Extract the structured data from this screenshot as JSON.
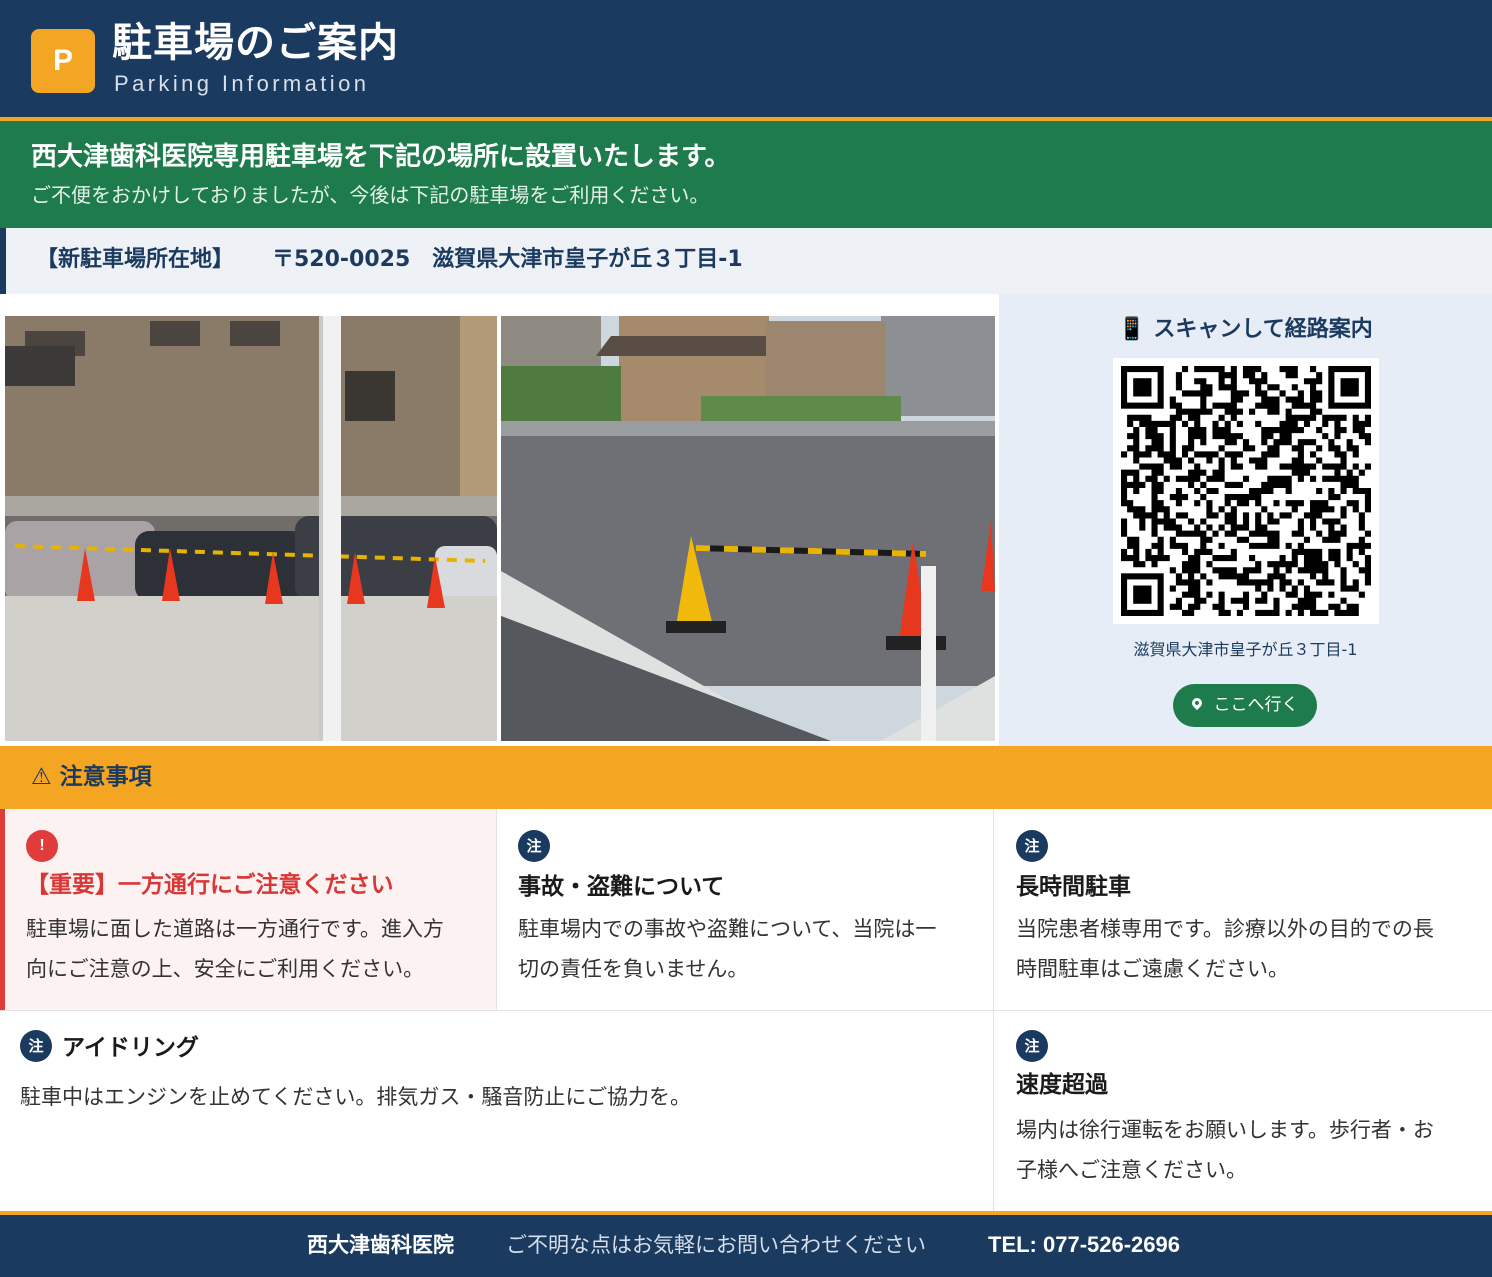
{
  "header": {
    "badge": "P",
    "title": "駐車場のご案内",
    "subtitle": "Parking Information"
  },
  "notice": {
    "main": "西大津歯科医院専用駐車場を下記の場所に設置いたします。",
    "sub": "ご不便をおかけしておりましたが、今後は下記の駐車場をご利用ください。"
  },
  "address": {
    "label": "【新駐車場所在地】",
    "text": "〒520-0025　滋賀県大津市皇子が丘３丁目-1"
  },
  "qr": {
    "title": "📱 スキャンして経路案内",
    "address": "滋賀県大津市皇子が丘３丁目-1",
    "button_label": "ここへ行く"
  },
  "caution": {
    "title": "⚠ 注意事項",
    "items": [
      {
        "badge": "!",
        "title": "【重要】一方通行にご注意ください",
        "lines": [
          "駐車場に面した道路は一方通行です。進入方",
          "向にご注意の上、安全にご利用ください。"
        ]
      },
      {
        "badge": "注",
        "title": "事故・盗難について",
        "lines": [
          "駐車場内での事故や盗難について、当院は一",
          "切の責任を負いません。"
        ]
      },
      {
        "badge": "注",
        "title": "長時間駐車",
        "lines": [
          "当院患者様専用です。診療以外の目的での長",
          "時間駐車はご遠慮ください。"
        ]
      },
      {
        "badge": "注",
        "title": "アイドリング",
        "lines": [
          "駐車中はエンジンを止めてください。排気ガス・騒音防止にご協力を。"
        ]
      },
      {
        "badge": "注",
        "title": "速度超過",
        "lines": [
          "場内は徐行運転をお願いします。歩行者・お",
          "子様へご注意ください。"
        ]
      }
    ]
  },
  "footer": {
    "name": "西大津歯科医院",
    "message": "ご不明な点はお気軽にお問い合わせください",
    "tel": "TEL: 077-526-2696"
  },
  "colors": {
    "navy": "#1b3a5f",
    "orange": "#f2a623",
    "green": "#1e7b4b",
    "red": "#e03c3c"
  }
}
